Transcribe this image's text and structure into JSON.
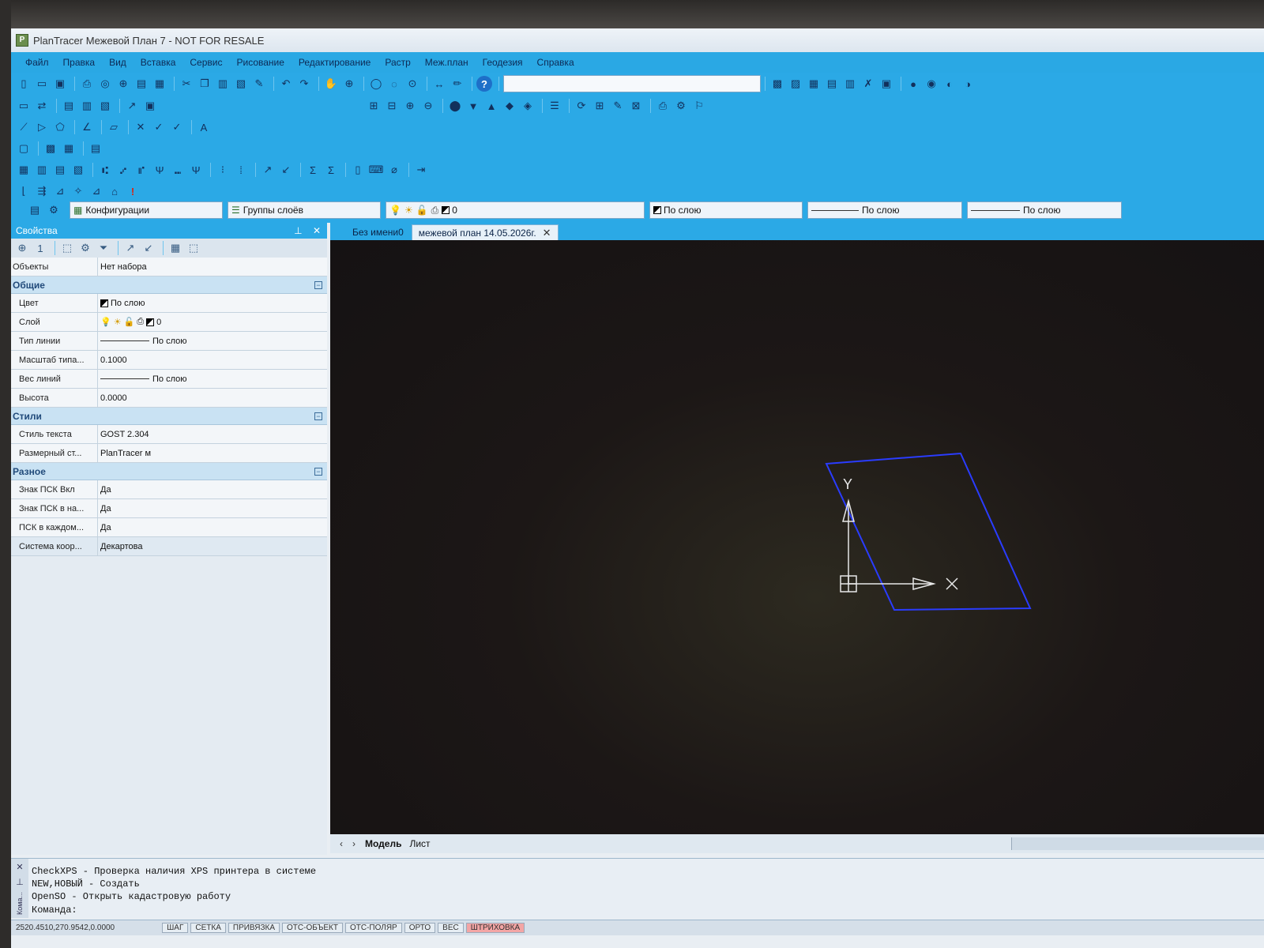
{
  "window": {
    "title": "PlanTracer Межевой План 7 - NOT FOR RESALE",
    "icon": "app-logo-icon"
  },
  "menu": [
    "Файл",
    "Правка",
    "Вид",
    "Вставка",
    "Сервис",
    "Рисование",
    "Редактирование",
    "Растр",
    "Меж.план",
    "Геодезия",
    "Справка"
  ],
  "search": {
    "value": ""
  },
  "layerbar": {
    "config": "Конфигурации",
    "groups": "Группы слоёв",
    "layer": "0",
    "color": "По слою",
    "linetype": "По слою",
    "lineweight": "По слою"
  },
  "properties": {
    "title": "Свойства",
    "objects_label": "Объекты",
    "objects_value": "Нет набора",
    "sections": {
      "general": "Общие",
      "styles": "Стили",
      "misc": "Разное"
    },
    "general": [
      {
        "key": "Цвет",
        "value": "По слою"
      },
      {
        "key": "Слой",
        "value": "0"
      },
      {
        "key": "Тип линии",
        "value": "По слою"
      },
      {
        "key": "Масштаб типа...",
        "value": "0.1000"
      },
      {
        "key": "Вес линий",
        "value": "По слою"
      },
      {
        "key": "Высота",
        "value": "0.0000"
      }
    ],
    "styles": [
      {
        "key": "Стиль текста",
        "value": "GOST 2.304"
      },
      {
        "key": "Размерный ст...",
        "value": "PlanTracer м"
      }
    ],
    "misc": [
      {
        "key": "Знак ПСК Вкл",
        "value": "Да"
      },
      {
        "key": "Знак ПСК в на...",
        "value": "Да"
      },
      {
        "key": "ПСК в каждом...",
        "value": "Да"
      },
      {
        "key": "Система коор...",
        "value": "Декартова"
      }
    ]
  },
  "doc_tabs": [
    "Без имени0",
    "межевой план 14.05.2026г."
  ],
  "canvas": {
    "ucs_x": "X",
    "ucs_y": "Y",
    "shape_color": "#2a3cff"
  },
  "model_tabs": [
    "Модель",
    "Лист"
  ],
  "command": {
    "lines": [
      "CheckXPS - Проверка наличия XPS принтера в системе",
      "NEW,НОВЫЙ - Создать",
      "OpenSO - Открыть кадастровую работу"
    ],
    "prompt": "Команда:",
    "side_label": "Кома..."
  },
  "status": {
    "coords": "2520.4510,270.9542,0.0000",
    "buttons": [
      "ШАГ",
      "СЕТКА",
      "ПРИВЯЗКА",
      "ОТС-ОБЪЕКТ",
      "ОТС-ПОЛЯР",
      "ОРТО",
      "ВЕС",
      "ШТРИХОВКА"
    ]
  }
}
